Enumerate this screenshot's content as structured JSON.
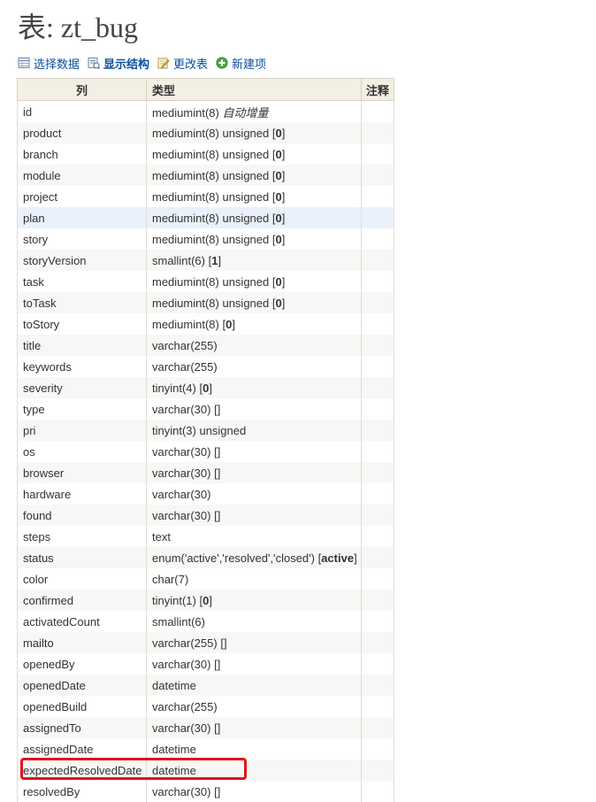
{
  "page": {
    "title": "表: zt_bug"
  },
  "toolbar": [
    {
      "label": "选择数据",
      "icon": "table-icon",
      "active": false
    },
    {
      "label": "显示结构",
      "icon": "structure-icon",
      "active": true
    },
    {
      "label": "更改表",
      "icon": "edit-icon",
      "active": false
    },
    {
      "label": "新建项",
      "icon": "add-icon",
      "active": false
    }
  ],
  "table": {
    "headers": [
      "列",
      "类型",
      "注释"
    ],
    "rows": [
      {
        "name": "id",
        "type": "mediumint(8)",
        "extra": "自动增量"
      },
      {
        "name": "product",
        "type": "mediumint(8) unsigned",
        "default": "0"
      },
      {
        "name": "branch",
        "type": "mediumint(8) unsigned",
        "default": "0"
      },
      {
        "name": "module",
        "type": "mediumint(8) unsigned",
        "default": "0"
      },
      {
        "name": "project",
        "type": "mediumint(8) unsigned",
        "default": "0"
      },
      {
        "name": "plan",
        "type": "mediumint(8) unsigned",
        "default": "0",
        "highlight": true
      },
      {
        "name": "story",
        "type": "mediumint(8) unsigned",
        "default": "0"
      },
      {
        "name": "storyVersion",
        "type": "smallint(6)",
        "default": "1"
      },
      {
        "name": "task",
        "type": "mediumint(8) unsigned",
        "default": "0"
      },
      {
        "name": "toTask",
        "type": "mediumint(8) unsigned",
        "default": "0"
      },
      {
        "name": "toStory",
        "type": "mediumint(8)",
        "default": "0"
      },
      {
        "name": "title",
        "type": "varchar(255)"
      },
      {
        "name": "keywords",
        "type": "varchar(255)"
      },
      {
        "name": "severity",
        "type": "tinyint(4)",
        "default": "0"
      },
      {
        "name": "type",
        "type": "varchar(30)",
        "default": ""
      },
      {
        "name": "pri",
        "type": "tinyint(3) unsigned"
      },
      {
        "name": "os",
        "type": "varchar(30)",
        "default": ""
      },
      {
        "name": "browser",
        "type": "varchar(30)",
        "default": ""
      },
      {
        "name": "hardware",
        "type": "varchar(30)"
      },
      {
        "name": "found",
        "type": "varchar(30)",
        "default": ""
      },
      {
        "name": "steps",
        "type": "text"
      },
      {
        "name": "status",
        "type": "enum('active','resolved','closed')",
        "default": "active"
      },
      {
        "name": "color",
        "type": "char(7)"
      },
      {
        "name": "confirmed",
        "type": "tinyint(1)",
        "default": "0"
      },
      {
        "name": "activatedCount",
        "type": "smallint(6)"
      },
      {
        "name": "mailto",
        "type": "varchar(255)",
        "default": ""
      },
      {
        "name": "openedBy",
        "type": "varchar(30)",
        "default": ""
      },
      {
        "name": "openedDate",
        "type": "datetime"
      },
      {
        "name": "openedBuild",
        "type": "varchar(255)"
      },
      {
        "name": "assignedTo",
        "type": "varchar(30)",
        "default": ""
      },
      {
        "name": "assignedDate",
        "type": "datetime"
      },
      {
        "name": "expectedResolvedDate",
        "type": "datetime",
        "annotated": true
      },
      {
        "name": "resolvedBy",
        "type": "varchar(30)",
        "default": ""
      }
    ]
  },
  "annotation": {
    "color": "#e4141b"
  }
}
